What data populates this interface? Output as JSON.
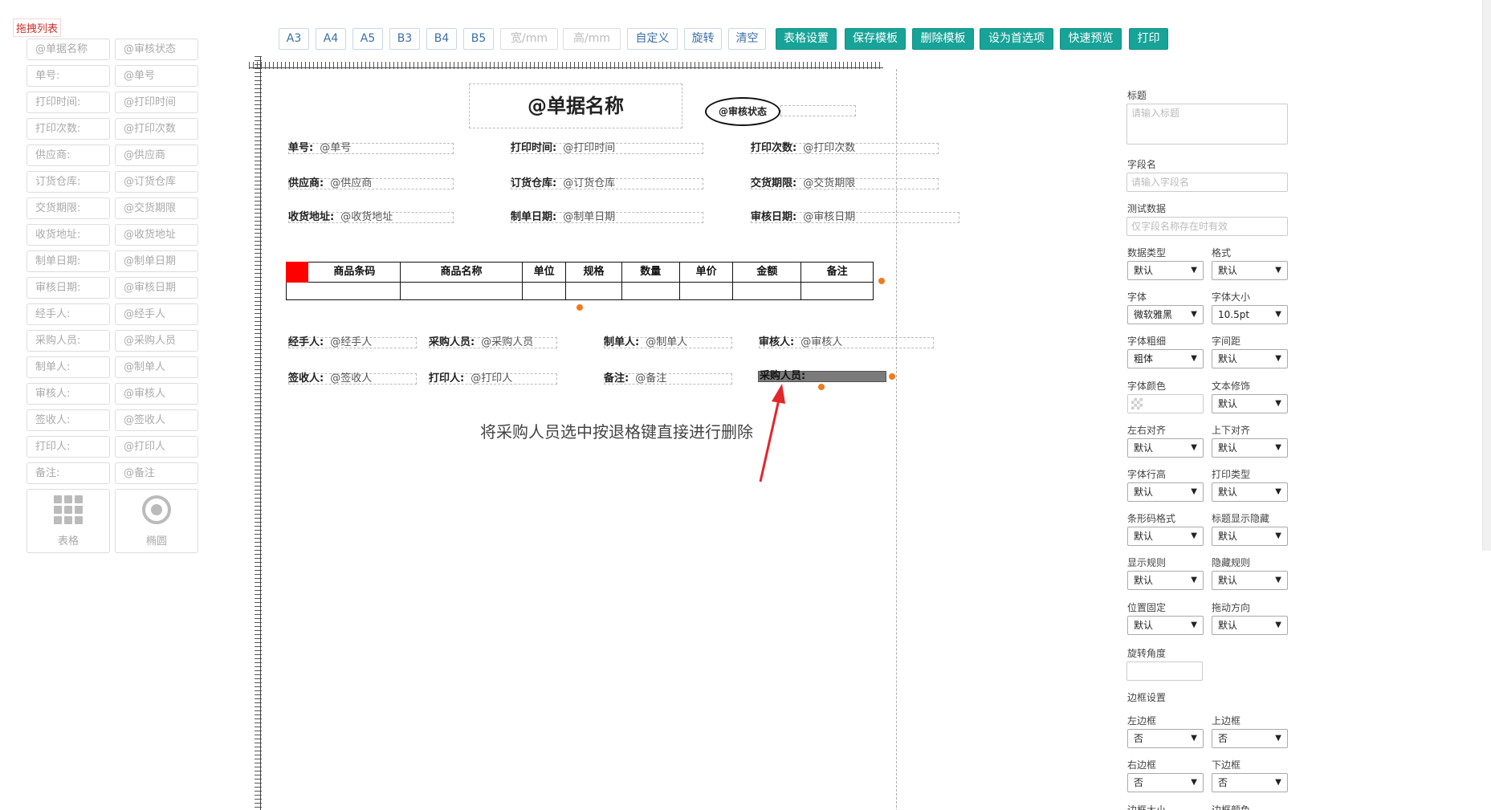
{
  "palette": {
    "title": "拖拽列表",
    "items": [
      {
        "label": "@单据名称",
        "value": "@审核状态"
      },
      {
        "label": "单号:",
        "value": "@单号"
      },
      {
        "label": "打印时间:",
        "value": "@打印时间"
      },
      {
        "label": "打印次数:",
        "value": "@打印次数"
      },
      {
        "label": "供应商:",
        "value": "@供应商"
      },
      {
        "label": "订货仓库:",
        "value": "@订货仓库"
      },
      {
        "label": "交货期限:",
        "value": "@交货期限"
      },
      {
        "label": "收货地址:",
        "value": "@收货地址"
      },
      {
        "label": "制单日期:",
        "value": "@制单日期"
      },
      {
        "label": "审核日期:",
        "value": "@审核日期"
      },
      {
        "label": "经手人:",
        "value": "@经手人"
      },
      {
        "label": "采购人员:",
        "value": "@采购人员"
      },
      {
        "label": "制单人:",
        "value": "@制单人"
      },
      {
        "label": "审核人:",
        "value": "@审核人"
      },
      {
        "label": "签收人:",
        "value": "@签收人"
      },
      {
        "label": "打印人:",
        "value": "@打印人"
      },
      {
        "label": "备注:",
        "value": "@备注"
      }
    ],
    "table_tool": {
      "label": "表格",
      "icon": "grid-icon"
    },
    "ellipse_tool": {
      "label": "椭圆",
      "icon": "circle-target-icon"
    }
  },
  "toolbar": {
    "sizes": [
      "A3",
      "A4",
      "A5",
      "B3",
      "B4",
      "B5"
    ],
    "width_placeholder": "宽/mm",
    "height_placeholder": "高/mm",
    "custom": "自定义",
    "rotate": "旋转",
    "clear": "清空",
    "table_settings": "表格设置",
    "save_template": "保存模板",
    "delete_template": "删除模板",
    "set_preferred": "设为首选项",
    "quick_preview": "快速预览",
    "print": "打印"
  },
  "canvas": {
    "title": "@单据名称",
    "status": "@审核状态",
    "rows": [
      [
        {
          "label": "单号:",
          "value": "@单号"
        },
        {
          "label": "打印时间:",
          "value": "@打印时间"
        },
        {
          "label": "打印次数:",
          "value": "@打印次数"
        }
      ],
      [
        {
          "label": "供应商:",
          "value": "@供应商"
        },
        {
          "label": "订货仓库:",
          "value": "@订货仓库"
        },
        {
          "label": "交货期限:",
          "value": "@交货期限"
        }
      ],
      [
        {
          "label": "收货地址:",
          "value": "@收货地址"
        },
        {
          "label": "制单日期:",
          "value": "@制单日期"
        },
        {
          "label": "审核日期:",
          "value": "@审核日期"
        }
      ]
    ],
    "table_columns": [
      "商品条码",
      "商品名称",
      "单位",
      "规格",
      "数量",
      "单价",
      "金额",
      "备注"
    ],
    "footer_rows": [
      [
        {
          "label": "经手人:",
          "value": "@经手人"
        },
        {
          "label": "采购人员:",
          "value": "@采购人员"
        },
        {
          "label": "制单人:",
          "value": "@制单人"
        },
        {
          "label": "审核人:",
          "value": "@审核人"
        }
      ],
      [
        {
          "label": "签收人:",
          "value": "@签收人"
        },
        {
          "label": "打印人:",
          "value": "@打印人"
        },
        {
          "label": "备注:",
          "value": "@备注"
        }
      ]
    ],
    "selected_field": "采购人员:",
    "annotation": "将采购人员选中按退格键直接进行删除"
  },
  "props": {
    "title_label": "标题",
    "title_placeholder": "请输入标题",
    "field_name_label": "字段名",
    "field_name_placeholder": "请输入字段名",
    "test_data_label": "测试数据",
    "test_data_placeholder": "仅字段名称存在时有效",
    "selects": [
      {
        "label": "数据类型",
        "value": "默认"
      },
      {
        "label": "格式",
        "value": "默认"
      },
      {
        "label": "字体",
        "value": "微软雅黑"
      },
      {
        "label": "字体大小",
        "value": "10.5pt"
      },
      {
        "label": "字体粗细",
        "value": "粗体"
      },
      {
        "label": "字间距",
        "value": "默认"
      },
      {
        "label": "字体颜色",
        "value": ""
      },
      {
        "label": "文本修饰",
        "value": "默认"
      },
      {
        "label": "左右对齐",
        "value": "默认"
      },
      {
        "label": "上下对齐",
        "value": "默认"
      },
      {
        "label": "字体行高",
        "value": "默认"
      },
      {
        "label": "打印类型",
        "value": "默认"
      },
      {
        "label": "条形码格式",
        "value": "默认"
      },
      {
        "label": "标题显示隐藏",
        "value": "默认"
      },
      {
        "label": "显示规则",
        "value": "默认"
      },
      {
        "label": "隐藏规则",
        "value": "默认"
      },
      {
        "label": "位置固定",
        "value": "默认"
      },
      {
        "label": "拖动方向",
        "value": "默认"
      }
    ],
    "rotation_label": "旋转角度",
    "border_settings_label": "边框设置",
    "border_selects": [
      {
        "label": "左边框",
        "value": "否"
      },
      {
        "label": "上边框",
        "value": "否"
      },
      {
        "label": "右边框",
        "value": "否"
      },
      {
        "label": "下边框",
        "value": "否"
      }
    ],
    "border_size_label": "边框大小",
    "border_color_label": "边框颜色"
  },
  "colors": {
    "accent": "#17a397",
    "link": "#3b6fa8",
    "handle": "#f07b1d",
    "annotation_arrow": "#e3262b"
  }
}
